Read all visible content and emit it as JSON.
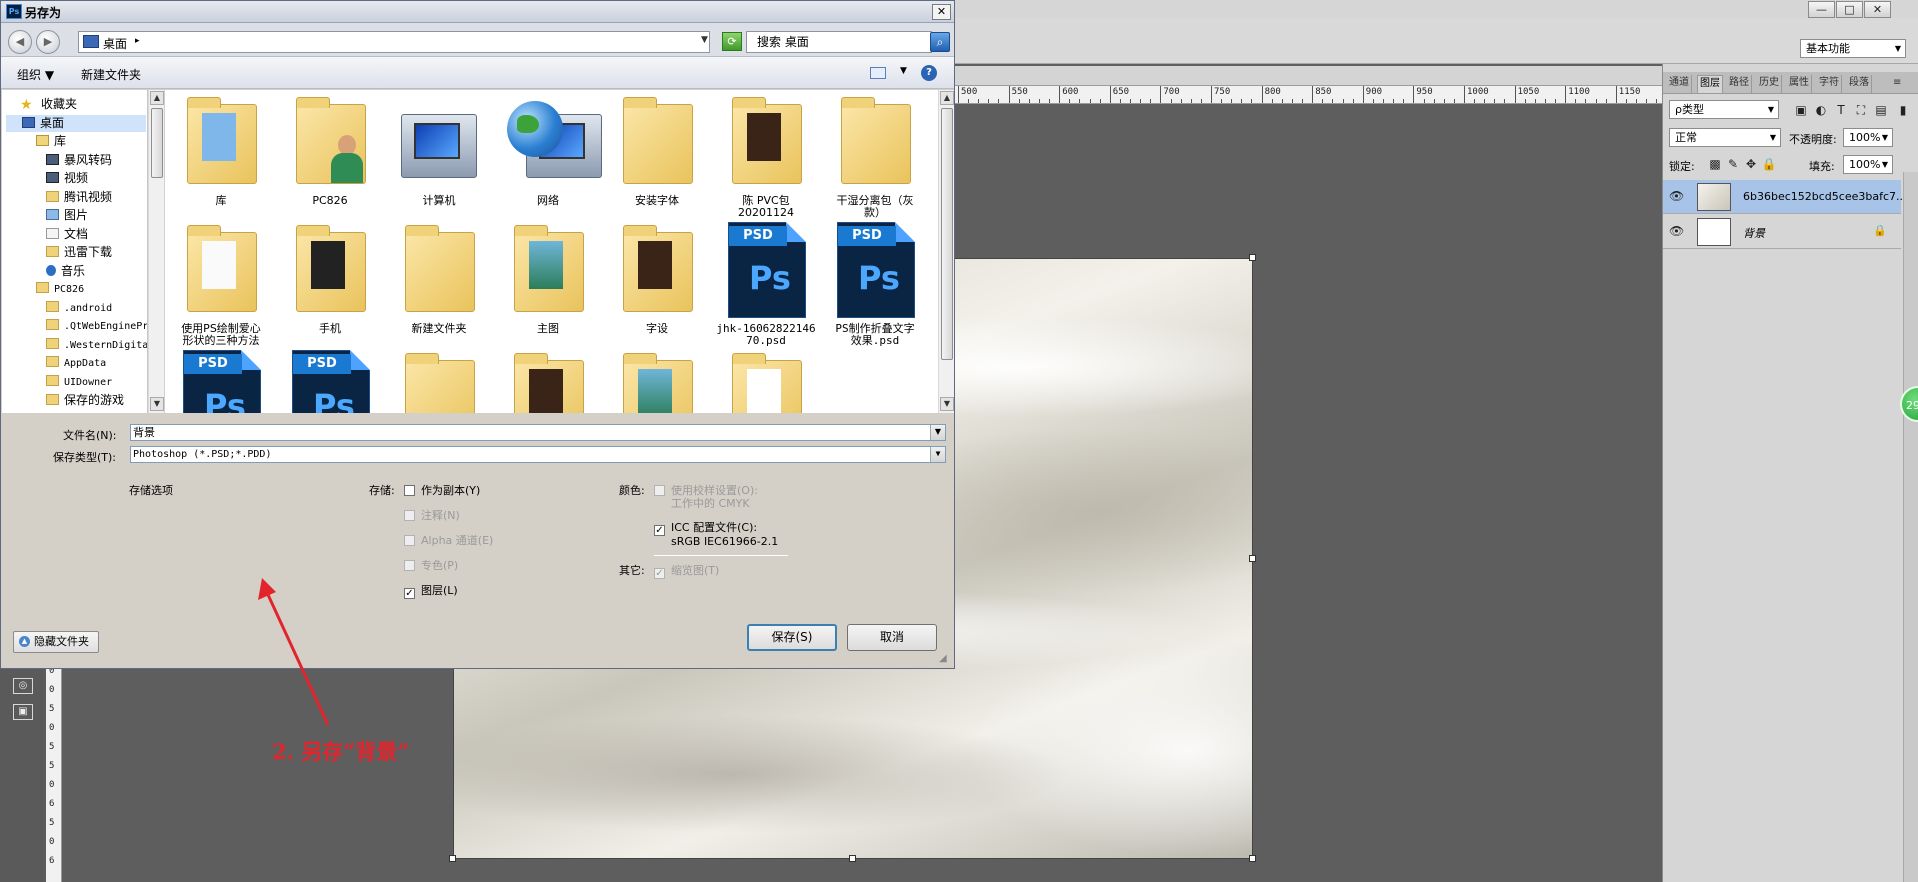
{
  "photoshop": {
    "workspace": "基本功能",
    "window_buttons": [
      "—",
      "□",
      "✕"
    ],
    "ruler_numbers": [
      "500",
      "550",
      "600",
      "650",
      "700",
      "750",
      "800",
      "850",
      "900",
      "950",
      "1000",
      "1050",
      "1100",
      "1150"
    ],
    "vruler_numbers": [
      "0",
      "0",
      "5",
      "0",
      "5",
      "5",
      "0",
      "6",
      "5",
      "0",
      "6"
    ],
    "badge": "29",
    "panel": {
      "tabs": [
        "通道",
        "图层",
        "路径",
        "历史",
        "属性",
        "字符",
        "段落"
      ],
      "active_tab": "图层",
      "filter_label": "ρ类型",
      "blend_mode": "正常",
      "opacity_label": "不透明度:",
      "opacity_value": "100%",
      "lock_label": "锁定:",
      "fill_label": "填充:",
      "fill_value": "100%",
      "layers": [
        {
          "name": "6b36bec152bcd5cee3bafc7...",
          "selected": true,
          "smart_object": true
        },
        {
          "name": "背景",
          "locked": true
        }
      ]
    },
    "tool_icons": [
      "camera-icon",
      "screen-mode-icon"
    ]
  },
  "dialog": {
    "title": "另存为",
    "title_icon": "Ps",
    "close": "✕",
    "nav": {
      "back": "◀",
      "forward": "▶",
      "address": "桌面",
      "address_arrow": "▸",
      "search_placeholder": "搜索 桌面",
      "dropdown": "▼"
    },
    "toolbar": {
      "organize": "组织 ▼",
      "new_folder": "新建文件夹",
      "help": "?"
    },
    "sidebar": [
      {
        "label": "收藏夹",
        "icon": "star",
        "indent": 18
      },
      {
        "label": "桌面",
        "icon": "blue",
        "indent": 20,
        "selected": true
      },
      {
        "label": "库",
        "icon": "lib",
        "indent": 34
      },
      {
        "label": "暴风转码",
        "icon": "vid",
        "indent": 44
      },
      {
        "label": "视频",
        "icon": "vid",
        "indent": 44
      },
      {
        "label": "腾讯视频",
        "icon": "folder",
        "indent": 44
      },
      {
        "label": "图片",
        "icon": "img",
        "indent": 44
      },
      {
        "label": "文档",
        "icon": "doc",
        "indent": 44
      },
      {
        "label": "迅雷下载",
        "icon": "folder",
        "indent": 44
      },
      {
        "label": "音乐",
        "icon": "music",
        "indent": 44
      },
      {
        "label": "PC826",
        "icon": "folder",
        "indent": 34,
        "small": true
      },
      {
        "label": ".android",
        "icon": "folder",
        "indent": 44,
        "small": true
      },
      {
        "label": ".QtWebEngineProcess",
        "icon": "folder",
        "indent": 44,
        "small": true
      },
      {
        "label": ".WesternDigital",
        "icon": "folder",
        "indent": 44,
        "small": true
      },
      {
        "label": "AppData",
        "icon": "folder",
        "indent": 44,
        "small": true
      },
      {
        "label": "UIDowner",
        "icon": "folder",
        "indent": 44,
        "small": true
      },
      {
        "label": "保存的游戏",
        "icon": "folder",
        "indent": 44
      }
    ],
    "files": [
      {
        "label": "库",
        "kind": "library"
      },
      {
        "label": "PC826",
        "kind": "user"
      },
      {
        "label": "计算机",
        "kind": "computer"
      },
      {
        "label": "网络",
        "kind": "network"
      },
      {
        "label": "安装字体",
        "kind": "folder"
      },
      {
        "label": "陈 PVC包\n20201124",
        "kind": "folder-dark"
      },
      {
        "label": "干湿分离包（灰\n款）",
        "kind": "folder"
      },
      {
        "label": "使用PS绘制爱心\n形状的三种方法",
        "kind": "folder-card"
      },
      {
        "label": "手机",
        "kind": "folder-phone"
      },
      {
        "label": "新建文件夹",
        "kind": "folder"
      },
      {
        "label": "主图",
        "kind": "folder-photo"
      },
      {
        "label": "字设",
        "kind": "folder-dark"
      },
      {
        "label": "jhk-16062822146\n70.psd",
        "kind": "psd"
      },
      {
        "label": "PS制作折叠文字\n效果.psd",
        "kind": "psd"
      },
      {
        "label": "",
        "kind": "psd"
      },
      {
        "label": "",
        "kind": "psd"
      },
      {
        "label": "",
        "kind": "folder"
      },
      {
        "label": "",
        "kind": "folder-dark"
      },
      {
        "label": "",
        "kind": "folder-photo"
      },
      {
        "label": "",
        "kind": "folder-white"
      }
    ],
    "filename_label": "文件名(N):",
    "filename_value": "背景",
    "filetype_label": "保存类型(T):",
    "filetype_value": "Photoshop (*.PSD;*.PDD)",
    "save_options_label": "存储选项",
    "storage_label": "存储:",
    "storage_options": [
      {
        "label": "作为副本(Y)",
        "checked": false,
        "disabled": false
      },
      {
        "label": "注释(N)",
        "checked": false,
        "disabled": true
      },
      {
        "label": "Alpha 通道(E)",
        "checked": false,
        "disabled": true
      },
      {
        "label": "专色(P)",
        "checked": false,
        "disabled": true
      },
      {
        "label": "图层(L)",
        "checked": true,
        "disabled": false
      }
    ],
    "color_label": "颜色:",
    "proof_option": {
      "line1": "使用校样设置(O):",
      "line2": "工作中的 CMYK",
      "checked": false,
      "disabled": true
    },
    "icc_option": {
      "line1": "ICC 配置文件(C):",
      "line2": "sRGB IEC61966-2.1",
      "checked": true,
      "disabled": false
    },
    "other_label": "其它:",
    "thumbnail_option": {
      "label": "缩览图(T)",
      "checked": true,
      "disabled": true
    },
    "save_button": "保存(S)",
    "cancel_button": "取消",
    "hide_folders": "隐藏文件夹"
  },
  "annotation": "2. 另存“背景”",
  "colors": {
    "annotation": "#e2252c",
    "selection": "#cfe3fb",
    "default_button_border": "#3c7fb1"
  }
}
